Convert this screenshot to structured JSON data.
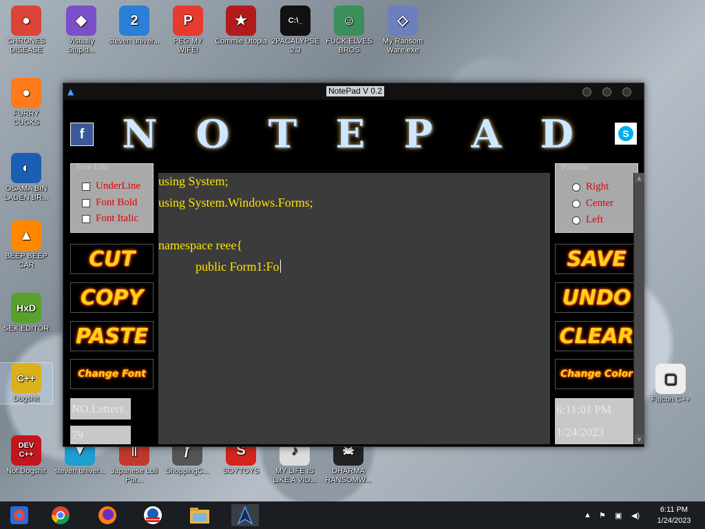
{
  "desktop": {
    "icons": [
      {
        "label": "CHRONES DISEASE",
        "glyph": "●",
        "color": "#db4437"
      },
      {
        "label": "Visually Stupid...",
        "glyph": "◆",
        "color": "#7b4fc7"
      },
      {
        "label": "steven univer...",
        "glyph": "2",
        "color": "#2b7fd6"
      },
      {
        "label": "PEG MY WIFE!",
        "glyph": "P",
        "color": "#e63b2e"
      },
      {
        "label": "Commie Utopia",
        "glyph": "★",
        "color": "#b31b1b"
      },
      {
        "label": "2PACALYPSE 2.3",
        "glyph": "C:\\_",
        "color": "#111111"
      },
      {
        "label": "FUCK ELVES BROS",
        "glyph": "☺",
        "color": "#3a8f5a"
      },
      {
        "label": "My Ransom Ware.exe",
        "glyph": "◇",
        "color": "#6e7fbf"
      },
      {
        "label": "FURRY CUCKS",
        "glyph": "●",
        "color": "#ff7a1a"
      },
      {
        "label": "OSAMA BIN LADEN BR...",
        "glyph": "◐",
        "color": "#1a5fb4"
      },
      {
        "label": "BEEP BEEP CAR",
        "glyph": "▲",
        "color": "#ff8800"
      },
      {
        "label": "SEX EDITOR",
        "glyph": "HxD",
        "color": "#5aa02c"
      },
      {
        "label": "Dogshit",
        "glyph": "C++",
        "color": "#d9b21a"
      },
      {
        "label": "Not Dogshit",
        "glyph": "DEV C++",
        "color": "#c4161c"
      },
      {
        "label": "steven univer...",
        "glyph": "▼",
        "color": "#1f9ed1"
      },
      {
        "label": "Japanese Loli Por...",
        "glyph": "||",
        "color": "#c0392b"
      },
      {
        "label": "ShoppingC...",
        "glyph": "ƒ",
        "color": "#555555"
      },
      {
        "label": "SOYTOYS",
        "glyph": "S",
        "color": "#d4241c"
      },
      {
        "label": "MY LIFE IS LIKE A VID...",
        "glyph": "♪",
        "color": "#dddddd"
      },
      {
        "label": "DHARMA RANSOMW...",
        "glyph": "☠",
        "color": "#222222"
      },
      {
        "label": "Falcon C++",
        "glyph": "▢",
        "color": "#eeeeee"
      }
    ]
  },
  "window": {
    "title": "NotePad V 0.2",
    "banner_letters": [
      "N",
      "O",
      "T",
      "E",
      "P",
      "A",
      "D"
    ],
    "facebook_glyph": "f",
    "skype_glyph": "S",
    "font_edit": {
      "legend": "Font Edit",
      "options": [
        "UnderLine",
        "Font Bold",
        "Font Italic"
      ]
    },
    "position": {
      "legend": "Position",
      "options": [
        "Right",
        "Center",
        "Left"
      ]
    },
    "buttons_left": [
      "CUT",
      "COPY",
      "PASTE",
      "Change Font"
    ],
    "buttons_right": [
      "SAVE",
      "UNDO",
      "CLEAR",
      "Change Color"
    ],
    "letters_label": "NO.Letters",
    "letters_value": "79",
    "time": "6:11:01 PM",
    "date": "1/24/2023",
    "editor_lines": [
      "using System;",
      "using System.Windows.Forms;",
      "",
      "namespace reee{",
      "            public Form1:Fo"
    ]
  },
  "taskbar": {
    "time": "6:11 PM",
    "date": "1/24/2023"
  }
}
